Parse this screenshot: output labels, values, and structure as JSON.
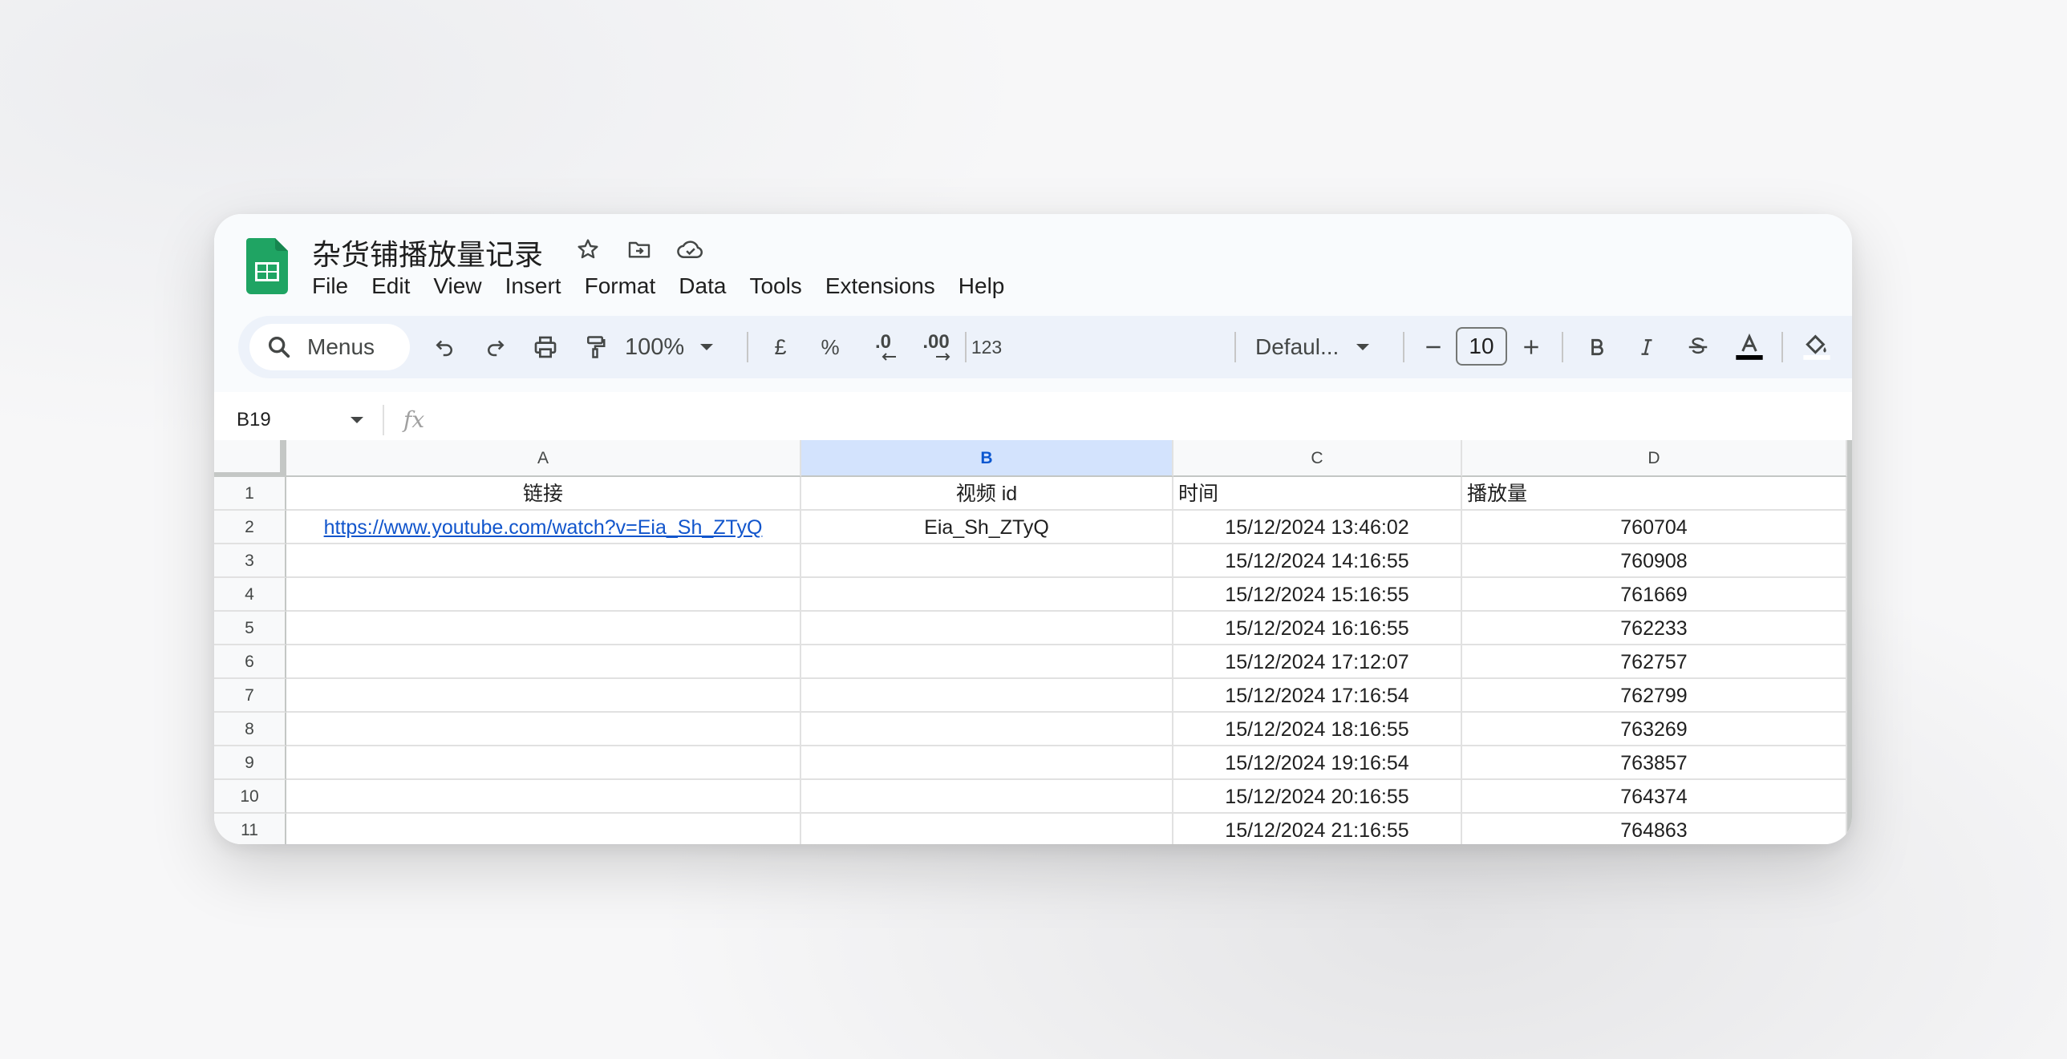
{
  "doc": {
    "title": "杂货铺播放量记录"
  },
  "menu": [
    "File",
    "Edit",
    "View",
    "Insert",
    "Format",
    "Data",
    "Tools",
    "Extensions",
    "Help"
  ],
  "toolbar": {
    "search_label": "Menus",
    "zoom": "100%",
    "currency": "£",
    "percent": "%",
    "decrease_decimal": ".0",
    "increase_decimal": ".00",
    "number_format": "123",
    "font": "Defaul...",
    "font_size": "10"
  },
  "formula_bar": {
    "name_box": "B19",
    "fx": "fx"
  },
  "sheet": {
    "selected_column": "B",
    "columns": [
      "A",
      "B",
      "C",
      "D"
    ],
    "rows": [
      {
        "num": "1",
        "a": "链接",
        "b": "视频 id",
        "c": "时间",
        "d": "播放量"
      },
      {
        "num": "2",
        "a": "https://www.youtube.com/watch?v=Eia_Sh_ZTyQ",
        "b": "Eia_Sh_ZTyQ",
        "c": "15/12/2024 13:46:02",
        "d": "760704"
      },
      {
        "num": "3",
        "a": "",
        "b": "",
        "c": "15/12/2024 14:16:55",
        "d": "760908"
      },
      {
        "num": "4",
        "a": "",
        "b": "",
        "c": "15/12/2024 15:16:55",
        "d": "761669"
      },
      {
        "num": "5",
        "a": "",
        "b": "",
        "c": "15/12/2024 16:16:55",
        "d": "762233"
      },
      {
        "num": "6",
        "a": "",
        "b": "",
        "c": "15/12/2024 17:12:07",
        "d": "762757"
      },
      {
        "num": "7",
        "a": "",
        "b": "",
        "c": "15/12/2024 17:16:54",
        "d": "762799"
      },
      {
        "num": "8",
        "a": "",
        "b": "",
        "c": "15/12/2024 18:16:55",
        "d": "763269"
      },
      {
        "num": "9",
        "a": "",
        "b": "",
        "c": "15/12/2024 19:16:54",
        "d": "763857"
      },
      {
        "num": "10",
        "a": "",
        "b": "",
        "c": "15/12/2024 20:16:55",
        "d": "764374"
      },
      {
        "num": "11",
        "a": "",
        "b": "",
        "c": "15/12/2024 21:16:55",
        "d": "764863"
      }
    ]
  },
  "colors": {
    "sheets_green": "#0f9d58",
    "selection_blue": "#d3e3fd",
    "link": "#1155cc",
    "toolbar_bg": "#edf2fa"
  }
}
